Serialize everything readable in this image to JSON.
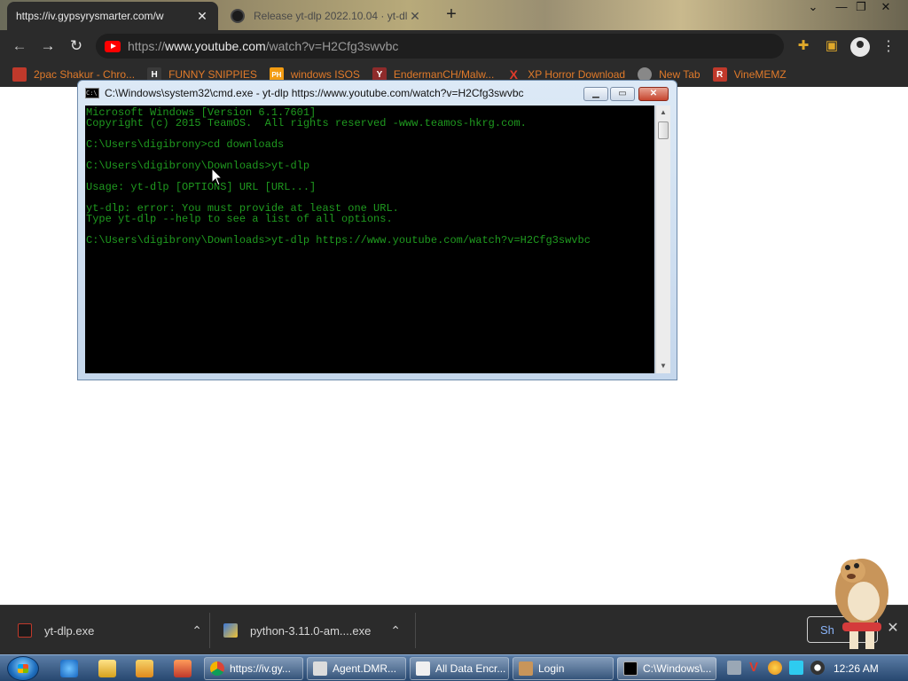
{
  "browser": {
    "tabs": [
      {
        "title": "https://iv.gypsyrysmarter.com/w",
        "active": true
      },
      {
        "title": "Release yt-dlp 2022.10.04 · yt-dl",
        "active": false
      }
    ],
    "new_tab_glyph": "+",
    "window_controls": {
      "dropdown": "⌄",
      "minimize": "—",
      "maximize": "❐",
      "close": "✕"
    },
    "url_prefix": "https://",
    "url_host": "www.youtube.com",
    "url_path": "/watch?v=H2Cfg3swvbc"
  },
  "bookmarks": [
    {
      "label": "2pac Shakur - Chro...",
      "icon": "folder-red-icon",
      "color": "#c0392b"
    },
    {
      "label": "FUNNY SNIPPIES",
      "icon": "h-icon",
      "color": "#3a3a3a",
      "glyph": "H"
    },
    {
      "label": "windows ISOS",
      "icon": "ph-icon",
      "color": "#f39c12",
      "glyph": "PH"
    },
    {
      "label": "EndermanCH/Malw...",
      "icon": "yt-red-icon",
      "color": "#8e2b2b",
      "glyph": "Y"
    },
    {
      "label": "XP Horror Download",
      "icon": "x-icon",
      "color": "#c0392b",
      "glyph": "X"
    },
    {
      "label": "New Tab",
      "icon": "chrome-icon",
      "color": "#888888"
    },
    {
      "label": "VineMEMZ",
      "icon": "r-icon",
      "color": "#c0392b",
      "glyph": "R"
    }
  ],
  "cmd": {
    "title": "C:\\Windows\\system32\\cmd.exe - yt-dlp  https://www.youtube.com/watch?v=H2Cfg3swvbc",
    "icon_glyph": "C:\\",
    "lines": [
      "Microsoft Windows [Version 6.1.7601]",
      "Copyright (c) 2015 TeamOS.  All rights reserved -www.teamos-hkrg.com.",
      "",
      "C:\\Users\\digibrony>cd downloads",
      "",
      "C:\\Users\\digibrony\\Downloads>yt-dlp",
      "",
      "Usage: yt-dlp [OPTIONS] URL [URL...]",
      "",
      "yt-dlp: error: You must provide at least one URL.",
      "Type yt-dlp --help to see a list of all options.",
      "",
      "C:\\Users\\digibrony\\Downloads>yt-dlp https://www.youtube.com/watch?v=H2Cfg3swvbc"
    ],
    "text_color": "#1f9a1f"
  },
  "downloads": [
    {
      "name": "yt-dlp.exe",
      "icon": "exe-icon"
    },
    {
      "name": "python-3.11.0-am....exe",
      "icon": "python-installer-icon"
    }
  ],
  "show_all_label": "Sh",
  "taskbar": {
    "items": [
      {
        "label": "https://iv.gy...",
        "icon": "chrome-icon"
      },
      {
        "label": "Agent.DMR...",
        "icon": "app-icon"
      },
      {
        "label": "All Data Encr...",
        "icon": "folder-icon"
      },
      {
        "label": "Login",
        "icon": "login-icon"
      },
      {
        "label": "C:\\Windows\\...",
        "icon": "cmd-icon",
        "active": true
      }
    ],
    "clock": "12:26 AM"
  }
}
